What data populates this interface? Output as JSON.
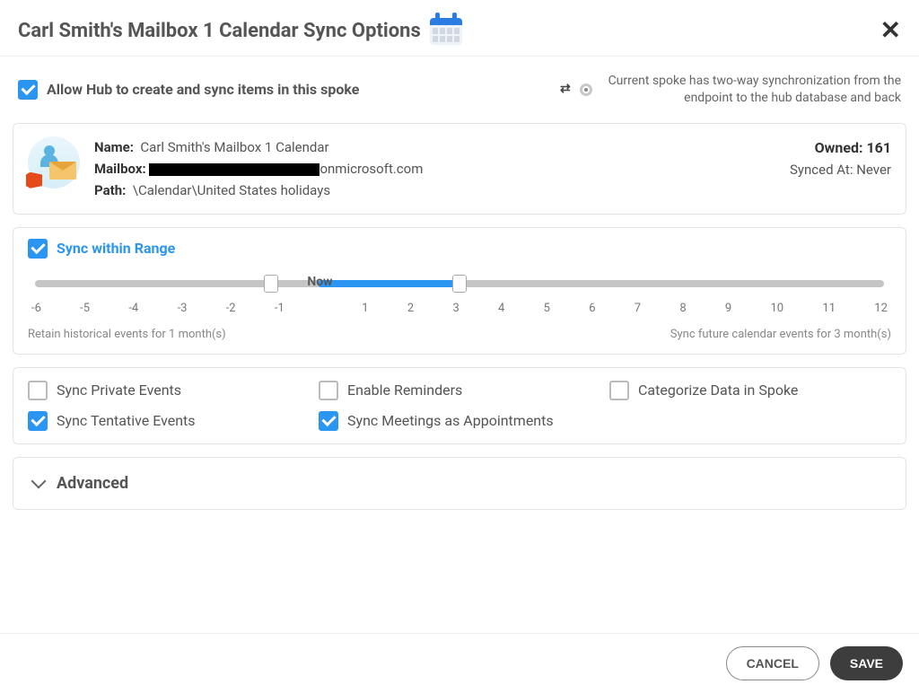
{
  "header": {
    "title": "Carl Smith's Mailbox 1 Calendar Sync Options"
  },
  "allow_sync": {
    "checked": true,
    "label": "Allow Hub to create and sync items in this spoke"
  },
  "sync_mode": {
    "description": "Current spoke has two-way synchronization from the endpoint to the hub database and back"
  },
  "info": {
    "name_label": "Name:",
    "name_value": "Carl Smith's Mailbox 1 Calendar",
    "mailbox_label": "Mailbox:",
    "mailbox_suffix": "onmicrosoft.com",
    "path_label": "Path:",
    "path_value": "\\Calendar\\United States holidays",
    "owned_label": "Owned:",
    "owned_value": "161",
    "synced_label": "Synced At:",
    "synced_value": "Never"
  },
  "range": {
    "checked": true,
    "label": "Sync within Range",
    "now_label": "Now",
    "min": -6,
    "max": 12,
    "left_handle": -1,
    "right_handle": 3,
    "ticks": [
      "-6",
      "-5",
      "-4",
      "-3",
      "-2",
      "-1",
      "",
      "1",
      "2",
      "3",
      "4",
      "5",
      "6",
      "7",
      "8",
      "9",
      "10",
      "11",
      "12"
    ],
    "retain_text": "Retain historical events for 1 month(s)",
    "future_text": "Sync future calendar events for 3 month(s)"
  },
  "options": {
    "sync_private": {
      "checked": false,
      "label": "Sync Private Events"
    },
    "enable_reminders": {
      "checked": false,
      "label": "Enable Reminders"
    },
    "categorize": {
      "checked": false,
      "label": "Categorize Data in Spoke"
    },
    "sync_tentative": {
      "checked": true,
      "label": "Sync Tentative Events"
    },
    "sync_meetings": {
      "checked": true,
      "label": "Sync Meetings as Appointments"
    }
  },
  "advanced": {
    "label": "Advanced",
    "expanded": false
  },
  "footer": {
    "cancel": "CANCEL",
    "save": "SAVE"
  }
}
